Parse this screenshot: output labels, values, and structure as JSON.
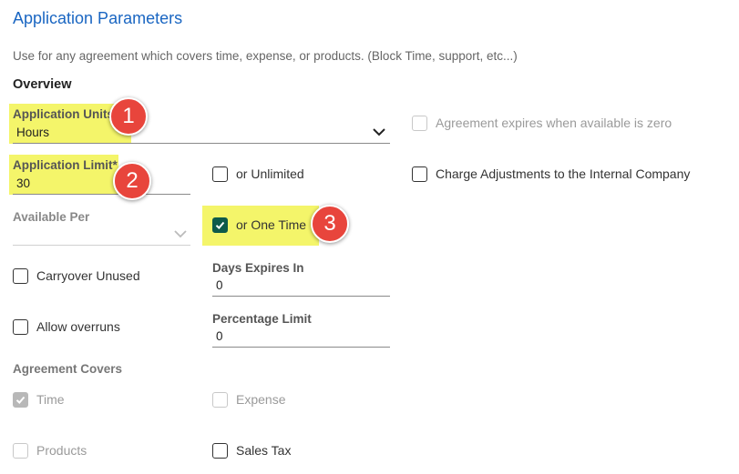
{
  "header": {
    "title": "Application Parameters",
    "description": "Use for any agreement which covers time, expense, or products. (Block Time, support, etc...)",
    "section": "Overview"
  },
  "application_units": {
    "label": "Application Units",
    "value": "Hours"
  },
  "application_limit": {
    "label": "Application Limit*",
    "value": "30"
  },
  "available_per": {
    "label": "Available Per",
    "value": ""
  },
  "checkboxes": {
    "unlimited": {
      "label": "or Unlimited",
      "checked": false
    },
    "one_time": {
      "label": "or One Time",
      "checked": true
    },
    "expires_zero": {
      "label": "Agreement expires when available is zero",
      "checked": false,
      "disabled": true
    },
    "charge_adjustments": {
      "label": "Charge Adjustments to the Internal Company",
      "checked": false
    },
    "carryover": {
      "label": "Carryover Unused",
      "checked": false
    },
    "overruns": {
      "label": "Allow overruns",
      "checked": false
    },
    "time": {
      "label": "Time",
      "checked": true,
      "disabled": true
    },
    "expense": {
      "label": "Expense",
      "checked": false,
      "disabled": true
    },
    "products": {
      "label": "Products",
      "checked": false,
      "disabled": true
    },
    "sales_tax": {
      "label": "Sales Tax",
      "checked": false
    }
  },
  "days_expires": {
    "label": "Days Expires In",
    "value": "0"
  },
  "percentage_limit": {
    "label": "Percentage Limit",
    "value": "0"
  },
  "agreement_covers": {
    "label": "Agreement Covers"
  },
  "badges": [
    "1",
    "2",
    "3"
  ],
  "colors": {
    "accent": "#1a66c2",
    "highlight": "#f4f56a",
    "badge": "#e8453c",
    "check": "#0e5a4a"
  }
}
